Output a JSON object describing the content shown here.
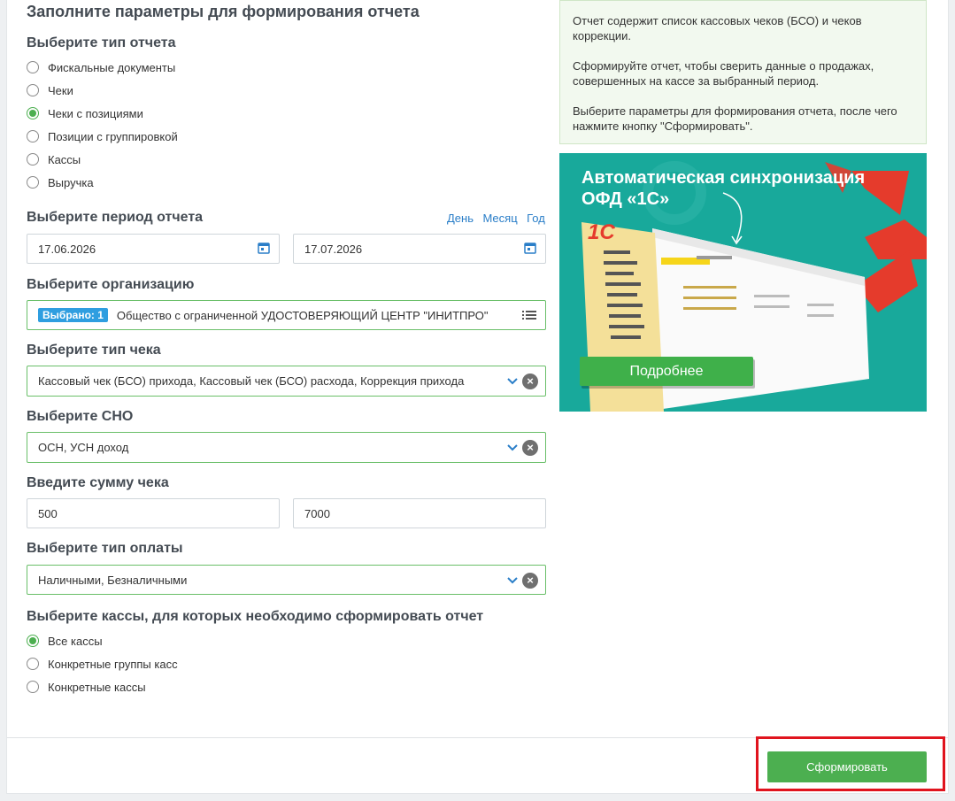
{
  "page_title": "Заполните параметры для формирования отчета",
  "report_type": {
    "title": "Выберите тип отчета",
    "options": [
      "Фискальные документы",
      "Чеки",
      "Чеки с позициями",
      "Позиции с группировкой",
      "Кассы",
      "Выручка"
    ],
    "selected_index": 2
  },
  "period": {
    "title": "Выберите период отчета",
    "links": [
      "День",
      "Месяц",
      "Год"
    ],
    "date_from": "17.06.2026",
    "date_to": "17.07.2026",
    "icon": "calendar-icon"
  },
  "organization": {
    "title": "Выберите организацию",
    "badge": "Выбрано: 1",
    "value": "Общество с ограниченной УДОСТОВЕРЯЮЩИЙ ЦЕНТР \"ИНИТПРО\"",
    "icon": "list-icon"
  },
  "receipt_type": {
    "title": "Выберите тип чека",
    "value": "Кассовый чек (БСО) прихода, Кассовый чек (БСО) расхода, Коррекция прихода"
  },
  "tax_system": {
    "title": "Выберите СНО",
    "value": "ОСН, УСН доход"
  },
  "amount": {
    "title": "Введите сумму чека",
    "from": "500",
    "to": "7000"
  },
  "payment_type": {
    "title": "Выберите тип оплаты",
    "value": "Наличными, Безналичными"
  },
  "registers": {
    "title": "Выберите кассы, для которых необходимо сформировать отчет",
    "options": [
      "Все кассы",
      "Конкретные группы касс",
      "Конкретные кассы"
    ],
    "selected_index": 0
  },
  "info": {
    "p1": "Отчет содержит список кассовых чеков (БСО) и чеков коррекции.",
    "p2": "Сформируйте отчет, чтобы сверить данные о продажах, совершенных на кассе за выбранный период.",
    "p3": "Выберите параметры для формирования отчета, после чего нажмите кнопку \"Сформировать\"."
  },
  "banner": {
    "title_line1": "Автоматическая синхронизация",
    "title_line2": "ОФД «1С»",
    "logo": "1С",
    "button": "Подробнее"
  },
  "submit_label": "Сформировать",
  "colors": {
    "accent_green": "#4caf50",
    "link_blue": "#2a7ec8",
    "badge_blue": "#2f9ee0",
    "banner_teal": "#18a99b",
    "highlight_red": "#e0141e"
  }
}
